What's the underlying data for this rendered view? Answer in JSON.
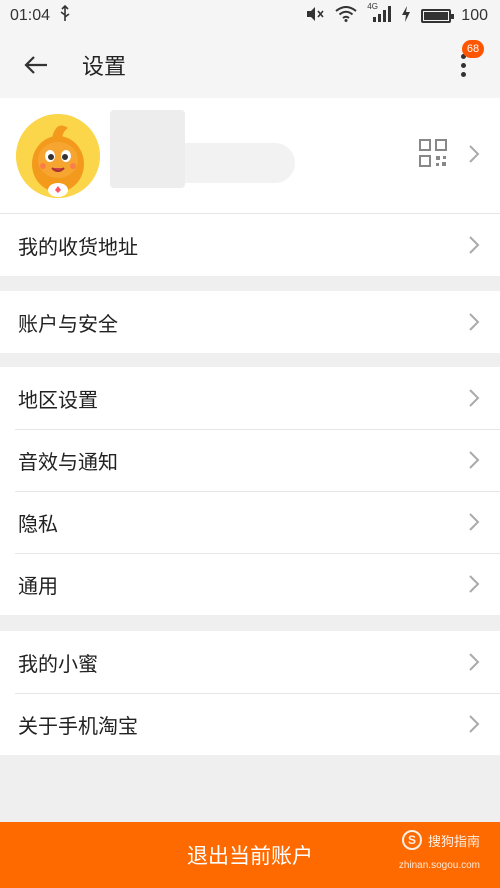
{
  "status_bar": {
    "time": "01:04",
    "network": "4G",
    "battery": "100"
  },
  "header": {
    "title": "设置",
    "badge_count": "68"
  },
  "settings": {
    "group1": [
      {
        "label": "我的收货地址"
      }
    ],
    "group2": [
      {
        "label": "账户与安全"
      }
    ],
    "group3": [
      {
        "label": "地区设置"
      },
      {
        "label": "音效与通知"
      },
      {
        "label": "隐私"
      },
      {
        "label": "通用"
      }
    ],
    "group4": [
      {
        "label": "我的小蜜"
      },
      {
        "label": "关于手机淘宝"
      }
    ]
  },
  "logout_button": {
    "label": "退出当前账户"
  },
  "watermark": {
    "text": "搜狗指南",
    "url": "zhinan.sogou.com",
    "logo": "S"
  },
  "colors": {
    "accent": "#ff6a00",
    "badge": "#ff5500",
    "background": "#efefef"
  },
  "icons": {
    "back": "arrow-left-icon",
    "more": "more-vertical-icon",
    "qr": "qr-code-icon",
    "chevron": "chevron-right-icon"
  }
}
